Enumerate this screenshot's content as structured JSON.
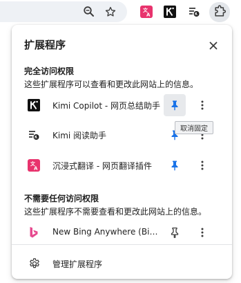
{
  "toolbar": {
    "icons": [
      "zoom-icon",
      "bookmark-star-icon",
      "immersive-translate-icon",
      "kimi-icon",
      "kimi-reader-icon",
      "extensions-puzzle-icon"
    ]
  },
  "popup": {
    "title": "扩展程序",
    "close_icon": "close-icon",
    "section_full_access": {
      "title": "完全访问权限",
      "description": "这些扩展程序可以查看和更改此网站上的信息。",
      "items": [
        {
          "name": "Kimi Copilot - 网页总结助手",
          "icon": "kimi-k-icon",
          "pinned": true,
          "pin_hover": true
        },
        {
          "name": "Kimi 阅读助手",
          "icon": "kimi-reader-icon",
          "pinned": true,
          "pin_hover": false
        },
        {
          "name": "沉浸式翻译 - 网页翻译插件",
          "icon": "immersive-translate-icon",
          "pinned": true,
          "pin_hover": false
        }
      ]
    },
    "section_no_access": {
      "title": "不需要任何访问权限",
      "description": "这些扩展程序不需要查看和更改此网站上的信息。",
      "items": [
        {
          "name": "New Bing Anywhere (Bing Chat)",
          "icon": "bing-icon",
          "pinned": false,
          "pin_hover": false
        }
      ]
    },
    "tooltip": "取消固定",
    "manage": {
      "label": "管理扩展程序",
      "icon": "gear-icon"
    }
  },
  "colors": {
    "pin_blue": "#1a73e8",
    "immersive_pink": "#e8336d",
    "bing_pink": "#e64a8f"
  }
}
